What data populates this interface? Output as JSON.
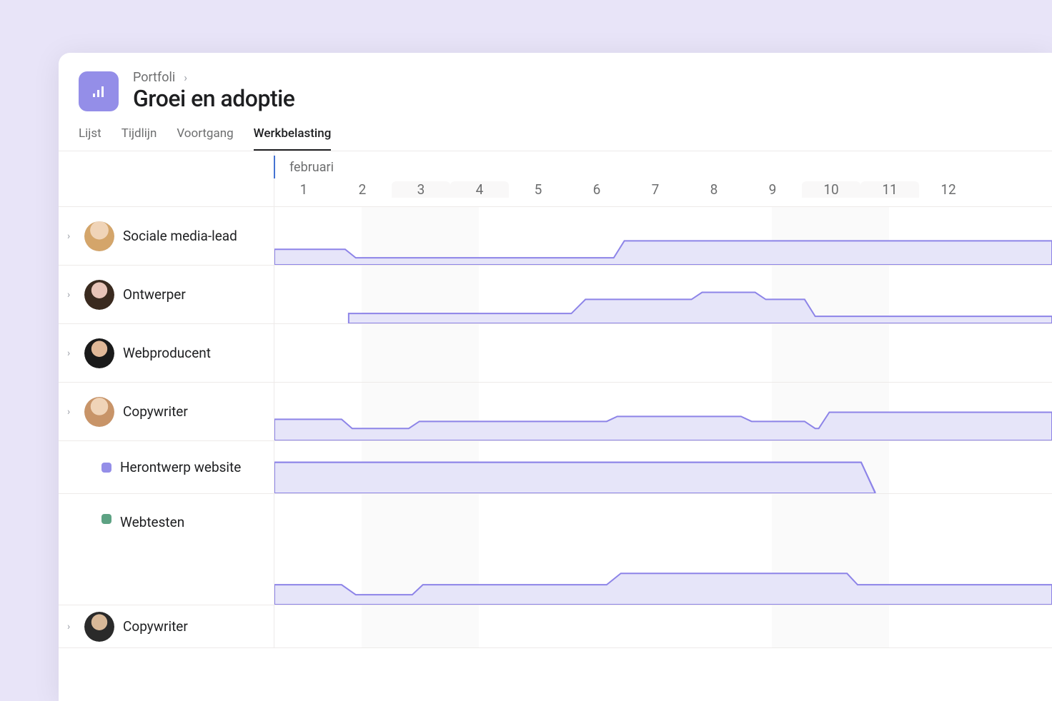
{
  "breadcrumb": {
    "parent": "Portfoli"
  },
  "page": {
    "title": "Groei en adoptie"
  },
  "tabs": [
    {
      "label": "Lijst",
      "active": false
    },
    {
      "label": "Tijdlijn",
      "active": false
    },
    {
      "label": "Voortgang",
      "active": false
    },
    {
      "label": "Werkbelasting",
      "active": true
    }
  ],
  "timeline": {
    "month": "februari",
    "days": [
      "1",
      "2",
      "3",
      "4",
      "5",
      "6",
      "7",
      "8",
      "9",
      "10",
      "11",
      "12"
    ],
    "highlighted_days": [
      2,
      3,
      9,
      10
    ]
  },
  "people": [
    {
      "label": "Sociale media-lead",
      "avatar_bg": "#e8c9a8",
      "avatar_hair": "#d4a56a"
    },
    {
      "label": "Ontwerper",
      "avatar_bg": "#e8c4b8",
      "avatar_hair": "#3a2a1f"
    },
    {
      "label": "Webproducent",
      "avatar_bg": "#e0b898",
      "avatar_hair": "#1a1a1a"
    },
    {
      "label": "Copywriter",
      "avatar_bg": "#f0d4b8",
      "avatar_hair": "#c89468"
    }
  ],
  "projects": [
    {
      "label": "Herontwerp website",
      "color": "#948ee8"
    },
    {
      "label": "Webtesten",
      "color": "#5da283"
    }
  ],
  "extra_person": {
    "label": "Copywriter",
    "avatar_bg": "#d8b898",
    "avatar_hair": "#2a2a2a"
  }
}
